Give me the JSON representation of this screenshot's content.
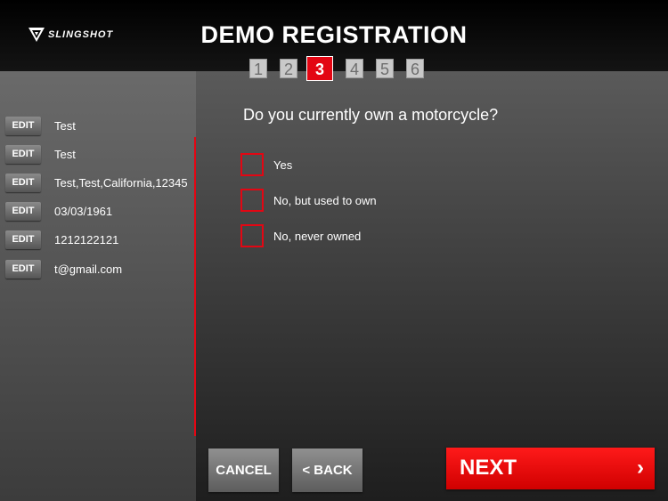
{
  "header": {
    "brand": "SLINGSHOT",
    "title": "DEMO REGISTRATION",
    "steps": [
      {
        "label": "1",
        "active": false
      },
      {
        "label": "2",
        "active": false
      },
      {
        "label": "3",
        "active": true
      },
      {
        "label": "4",
        "active": false
      },
      {
        "label": "5",
        "active": false
      },
      {
        "label": "6",
        "active": false
      }
    ]
  },
  "sidebar": {
    "edit_label": "EDIT",
    "entries": [
      {
        "value": "Test"
      },
      {
        "value": "Test"
      },
      {
        "value": "Test,Test,California,12345"
      },
      {
        "value": "03/03/1961"
      },
      {
        "value": "1212122121"
      },
      {
        "value": "t@gmail.com"
      }
    ]
  },
  "main": {
    "question": "Do you currently own a motorcycle?",
    "options": [
      {
        "label": "Yes",
        "checked": false
      },
      {
        "label": "No, but used to own",
        "checked": false
      },
      {
        "label": "No, never owned",
        "checked": false
      }
    ]
  },
  "footer": {
    "cancel_label": "CANCEL",
    "back_label": "< BACK",
    "next_label": "NEXT",
    "next_chevron": "›"
  },
  "colors": {
    "accent": "#e30613",
    "step_inactive": "#c9c9c9",
    "background": "#1a1a1a"
  }
}
